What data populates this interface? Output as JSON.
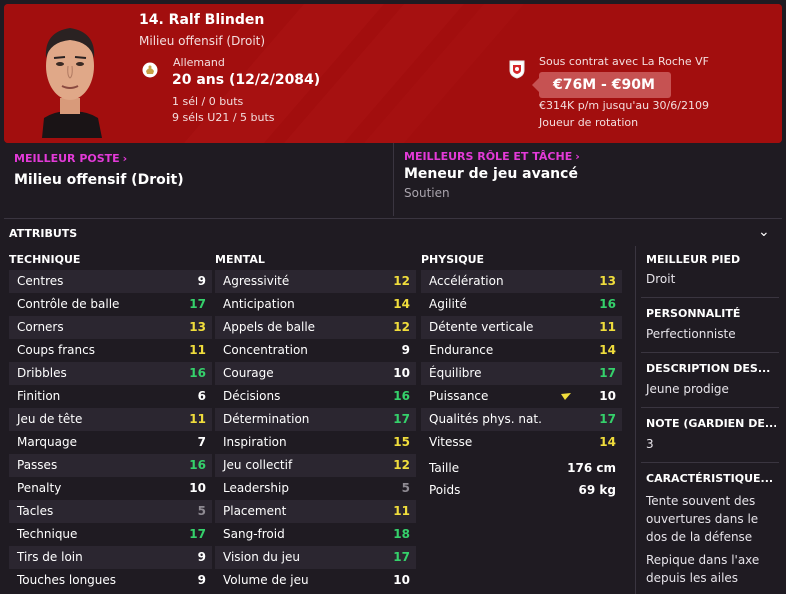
{
  "header": {
    "name": "14. Ralf Blinden",
    "position": "Milieu offensif (Droit)",
    "nationality": "Allemand",
    "age": "20 ans (12/2/2084)",
    "caps": "1 sél / 0 buts",
    "u21": "9 séls U21 / 5 buts",
    "contract": "Sous contrat avec La Roche VF",
    "value": "€76M - €90M",
    "wage": "€314K p/m jusqu'au 30/6/2109",
    "squad_status": "Joueur de rotation"
  },
  "best_position": {
    "title": "MEILLEUR POSTE",
    "value": "Milieu offensif (Droit)"
  },
  "best_role": {
    "title": "MEILLEURS RÔLE ET TÂCHE",
    "value": "Meneur de jeu avancé",
    "duty": "Soutien"
  },
  "attributes": {
    "title": "ATTRIBUTS",
    "technique": {
      "header": "TECHNIQUE",
      "rows": [
        {
          "label": "Centres",
          "value": "9",
          "color": "white"
        },
        {
          "label": "Contrôle de balle",
          "value": "17",
          "color": "green"
        },
        {
          "label": "Corners",
          "value": "13",
          "color": "yellow"
        },
        {
          "label": "Coups francs",
          "value": "11",
          "color": "yellow"
        },
        {
          "label": "Dribbles",
          "value": "16",
          "color": "green"
        },
        {
          "label": "Finition",
          "value": "6",
          "color": "white"
        },
        {
          "label": "Jeu de tête",
          "value": "11",
          "color": "yellow"
        },
        {
          "label": "Marquage",
          "value": "7",
          "color": "white"
        },
        {
          "label": "Passes",
          "value": "16",
          "color": "green"
        },
        {
          "label": "Penalty",
          "value": "10",
          "color": "white"
        },
        {
          "label": "Tacles",
          "value": "5",
          "color": "grey"
        },
        {
          "label": "Technique",
          "value": "17",
          "color": "green"
        },
        {
          "label": "Tirs de loin",
          "value": "9",
          "color": "white"
        },
        {
          "label": "Touches longues",
          "value": "9",
          "color": "white"
        }
      ]
    },
    "mental": {
      "header": "MENTAL",
      "rows": [
        {
          "label": "Agressivité",
          "value": "12",
          "color": "yellow"
        },
        {
          "label": "Anticipation",
          "value": "14",
          "color": "yellow"
        },
        {
          "label": "Appels de balle",
          "value": "12",
          "color": "yellow"
        },
        {
          "label": "Concentration",
          "value": "9",
          "color": "white"
        },
        {
          "label": "Courage",
          "value": "10",
          "color": "white"
        },
        {
          "label": "Décisions",
          "value": "16",
          "color": "green"
        },
        {
          "label": "Détermination",
          "value": "17",
          "color": "green"
        },
        {
          "label": "Inspiration",
          "value": "15",
          "color": "yellow"
        },
        {
          "label": "Jeu collectif",
          "value": "12",
          "color": "yellow"
        },
        {
          "label": "Leadership",
          "value": "5",
          "color": "grey"
        },
        {
          "label": "Placement",
          "value": "11",
          "color": "yellow"
        },
        {
          "label": "Sang-froid",
          "value": "18",
          "color": "green"
        },
        {
          "label": "Vision du jeu",
          "value": "17",
          "color": "green"
        },
        {
          "label": "Volume de jeu",
          "value": "10",
          "color": "white"
        }
      ]
    },
    "physique": {
      "header": "PHYSIQUE",
      "rows": [
        {
          "label": "Accélération",
          "value": "13",
          "color": "yellow"
        },
        {
          "label": "Agilité",
          "value": "16",
          "color": "green"
        },
        {
          "label": "Détente verticale",
          "value": "11",
          "color": "yellow"
        },
        {
          "label": "Endurance",
          "value": "14",
          "color": "yellow"
        },
        {
          "label": "Équilibre",
          "value": "17",
          "color": "green"
        },
        {
          "label": "Puissance",
          "value": "10",
          "color": "white"
        },
        {
          "label": "Qualités phys. nat.",
          "value": "17",
          "color": "green"
        },
        {
          "label": "Vitesse",
          "value": "14",
          "color": "yellow"
        }
      ],
      "height_label": "Taille",
      "height_value": "176 cm",
      "weight_label": "Poids",
      "weight_value": "69 kg"
    }
  },
  "side": {
    "foot_title": "MEILLEUR PIED",
    "foot_value": "Droit",
    "personality_title": "PERSONNALITÉ",
    "personality_value": "Perfectionniste",
    "media_title": "DESCRIPTION DES...",
    "media_value": "Jeune prodige",
    "gk_title": "NOTE (GARDIEN DE...",
    "gk_value": "3",
    "traits_title": "CARACTÉRISTIQUE...",
    "trait1": "Tente souvent des ouvertures dans le dos de la défense",
    "trait2": "Repique dans l'axe depuis les ailes"
  },
  "colors": {
    "header_red": "#a20e0e",
    "accent_magenta": "#e33ad8",
    "attr_green": "#35d16b",
    "attr_yellow": "#f0dd3c",
    "attr_grey": "#8e8a92"
  },
  "icons": {
    "nationality": "germany-flag-icon",
    "club": "club-badge-icon",
    "puissance_trend": "arrow-down-icon",
    "collapse": "chevron-down-icon"
  }
}
